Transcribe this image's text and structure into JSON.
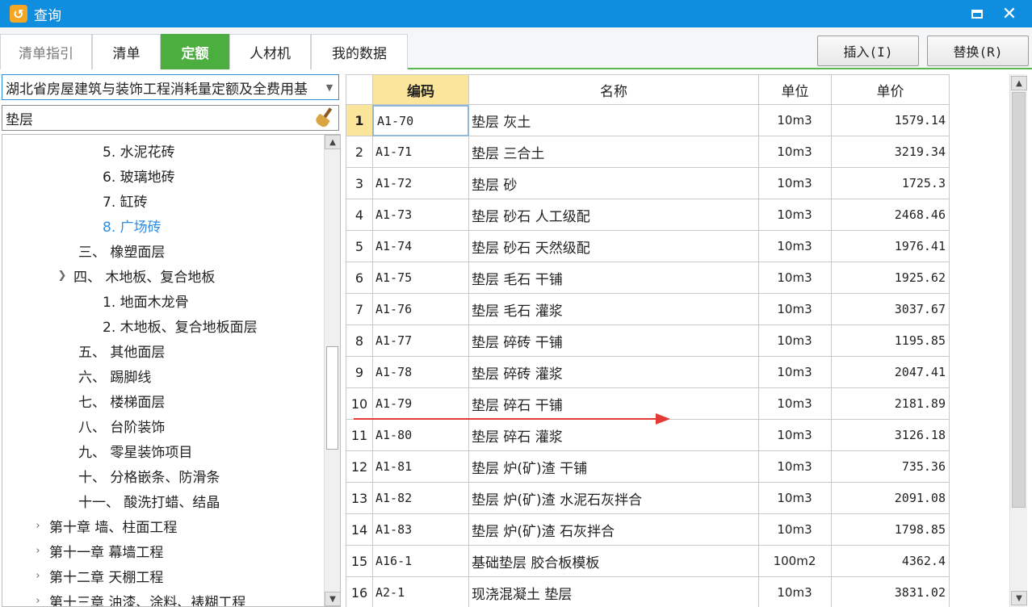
{
  "window": {
    "title": "查询",
    "app_icon": "app-logo-icon"
  },
  "tabs": [
    {
      "label": "清单指引",
      "state": "disabled"
    },
    {
      "label": "清单",
      "state": "normal"
    },
    {
      "label": "定额",
      "state": "active"
    },
    {
      "label": "人材机",
      "state": "normal"
    },
    {
      "label": "我的数据",
      "state": "normal"
    }
  ],
  "toolbar": {
    "insert_label": "插入(I)",
    "replace_label": "替换(R)"
  },
  "library": {
    "selected": "湖北省房屋建筑与装饰工程消耗量定额及全费用基"
  },
  "search": {
    "value": "垫层"
  },
  "tree": [
    {
      "label": "5. 水泥花砖",
      "level": 3,
      "selected": false
    },
    {
      "label": "6. 玻璃地砖",
      "level": 3,
      "selected": false
    },
    {
      "label": "7. 缸砖",
      "level": 3,
      "selected": false
    },
    {
      "label": "8. 广场砖",
      "level": 3,
      "selected": true
    },
    {
      "label": "三、 橡塑面层",
      "level": 2,
      "selected": false
    },
    {
      "label": "四、 木地板、复合地板",
      "level": 2,
      "selected": false,
      "expanded": true
    },
    {
      "label": "1. 地面木龙骨",
      "level": 3,
      "selected": false
    },
    {
      "label": "2. 木地板、复合地板面层",
      "level": 3,
      "selected": false
    },
    {
      "label": "五、 其他面层",
      "level": 2,
      "selected": false
    },
    {
      "label": "六、 踢脚线",
      "level": 2,
      "selected": false
    },
    {
      "label": "七、 楼梯面层",
      "level": 2,
      "selected": false
    },
    {
      "label": "八、 台阶装饰",
      "level": 2,
      "selected": false
    },
    {
      "label": "九、 零星装饰项目",
      "level": 2,
      "selected": false
    },
    {
      "label": "十、 分格嵌条、防滑条",
      "level": 2,
      "selected": false
    },
    {
      "label": "十一、 酸洗打蜡、结晶",
      "level": 2,
      "selected": false
    },
    {
      "label": "第十章 墙、柱面工程",
      "level": 1,
      "selected": false,
      "expanded": false
    },
    {
      "label": "第十一章 幕墙工程",
      "level": 1,
      "selected": false,
      "expanded": false
    },
    {
      "label": "第十二章 天棚工程",
      "level": 1,
      "selected": false,
      "expanded": false
    },
    {
      "label": "第十三章 油漆、涂料、裱糊工程",
      "level": 1,
      "selected": false,
      "expanded": false
    }
  ],
  "table": {
    "headers": {
      "code": "编码",
      "name": "名称",
      "unit": "单位",
      "price": "单价"
    },
    "rows": [
      {
        "idx": "1",
        "code": "A1-70",
        "name": "垫层 灰土",
        "unit": "10m3",
        "price": "1579.14"
      },
      {
        "idx": "2",
        "code": "A1-71",
        "name": "垫层 三合土",
        "unit": "10m3",
        "price": "3219.34"
      },
      {
        "idx": "3",
        "code": "A1-72",
        "name": "垫层 砂",
        "unit": "10m3",
        "price": "1725.3"
      },
      {
        "idx": "4",
        "code": "A1-73",
        "name": "垫层 砂石 人工级配",
        "unit": "10m3",
        "price": "2468.46"
      },
      {
        "idx": "5",
        "code": "A1-74",
        "name": "垫层 砂石 天然级配",
        "unit": "10m3",
        "price": "1976.41"
      },
      {
        "idx": "6",
        "code": "A1-75",
        "name": "垫层 毛石 干铺",
        "unit": "10m3",
        "price": "1925.62"
      },
      {
        "idx": "7",
        "code": "A1-76",
        "name": "垫层 毛石 灌浆",
        "unit": "10m3",
        "price": "3037.67"
      },
      {
        "idx": "8",
        "code": "A1-77",
        "name": "垫层 碎砖 干铺",
        "unit": "10m3",
        "price": "1195.85"
      },
      {
        "idx": "9",
        "code": "A1-78",
        "name": "垫层 碎砖 灌浆",
        "unit": "10m3",
        "price": "2047.41"
      },
      {
        "idx": "10",
        "code": "A1-79",
        "name": "垫层 碎石 干铺",
        "unit": "10m3",
        "price": "2181.89"
      },
      {
        "idx": "11",
        "code": "A1-80",
        "name": "垫层 碎石 灌浆",
        "unit": "10m3",
        "price": "3126.18"
      },
      {
        "idx": "12",
        "code": "A1-81",
        "name": "垫层 炉(矿)渣 干铺",
        "unit": "10m3",
        "price": "735.36"
      },
      {
        "idx": "13",
        "code": "A1-82",
        "name": "垫层 炉(矿)渣 水泥石灰拌合",
        "unit": "10m3",
        "price": "2091.08"
      },
      {
        "idx": "14",
        "code": "A1-83",
        "name": "垫层 炉(矿)渣 石灰拌合",
        "unit": "10m3",
        "price": "1798.85"
      },
      {
        "idx": "15",
        "code": "A16-1",
        "name": "基础垫层 胶合板模板",
        "unit": "100m2",
        "price": "4362.4"
      },
      {
        "idx": "16",
        "code": "A2-1",
        "name": "现浇混凝土 垫层",
        "unit": "10m3",
        "price": "3831.02"
      }
    ],
    "current_row": 0
  },
  "colors": {
    "titlebar": "#0f8ee0",
    "active_tab": "#4cae3f",
    "header_highlight": "#fbe59a",
    "tree_selected": "#2a8ee8",
    "annotation_arrow": "#e53935"
  }
}
